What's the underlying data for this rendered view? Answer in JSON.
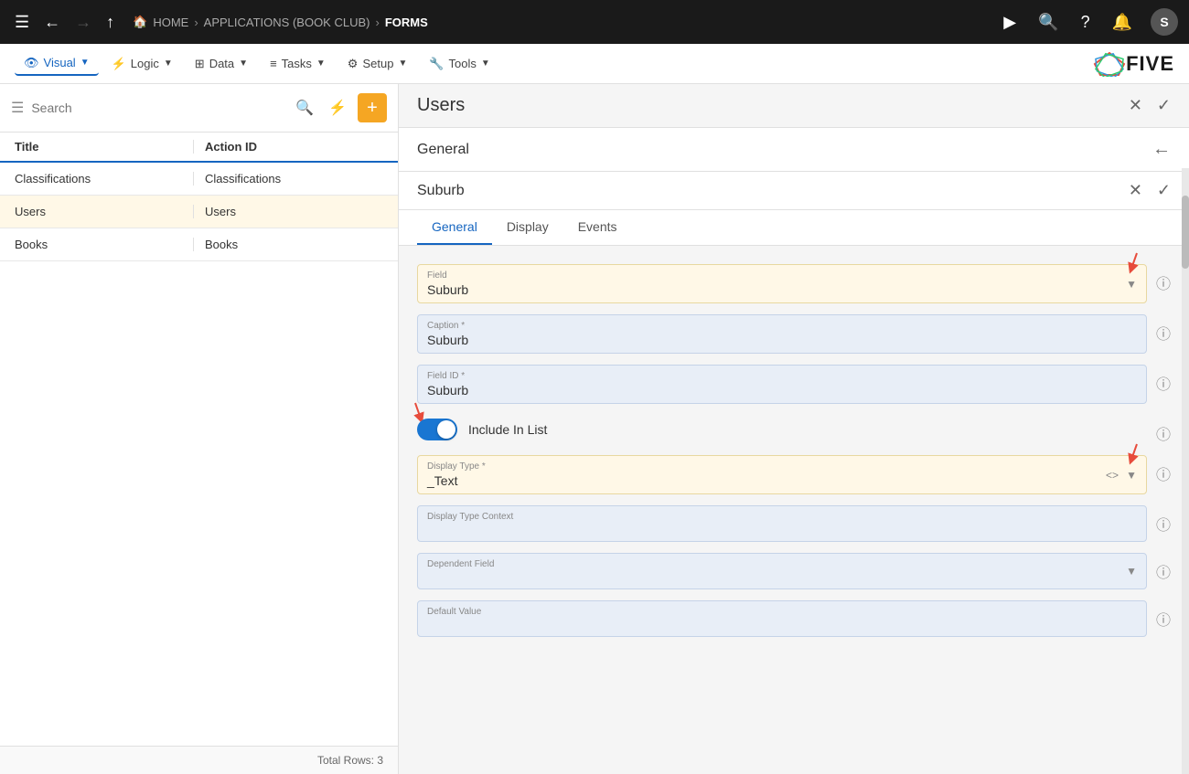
{
  "topNav": {
    "breadcrumbs": [
      {
        "label": "HOME",
        "icon": "🏠"
      },
      {
        "label": "APPLICATIONS (BOOK CLUB)"
      },
      {
        "label": "FORMS",
        "active": true
      }
    ],
    "avatar": "S"
  },
  "secondNav": {
    "items": [
      {
        "label": "Visual",
        "active": true,
        "icon": "👁"
      },
      {
        "label": "Logic",
        "icon": "⚡"
      },
      {
        "label": "Data",
        "icon": "⊞"
      },
      {
        "label": "Tasks",
        "icon": "≡"
      },
      {
        "label": "Setup",
        "icon": "⚙"
      },
      {
        "label": "Tools",
        "icon": "🔧"
      }
    ]
  },
  "leftPanel": {
    "searchPlaceholder": "Search",
    "tableHeaders": {
      "title": "Title",
      "actionId": "Action ID"
    },
    "rows": [
      {
        "title": "Classifications",
        "actionId": "Classifications",
        "selected": false
      },
      {
        "title": "Users",
        "actionId": "Users",
        "selected": true
      },
      {
        "title": "Books",
        "actionId": "Books",
        "selected": false
      }
    ],
    "totalRows": "Total Rows: 3"
  },
  "rightPanel": {
    "usersTitle": "Users",
    "generalTitle": "General",
    "suburbTitle": "Suburb",
    "tabs": [
      {
        "label": "General",
        "active": true
      },
      {
        "label": "Display",
        "active": false
      },
      {
        "label": "Events",
        "active": false
      }
    ],
    "fields": {
      "field": {
        "label": "Field",
        "value": "Suburb"
      },
      "caption": {
        "label": "Caption *",
        "value": "Suburb"
      },
      "fieldId": {
        "label": "Field ID *",
        "value": "Suburb"
      },
      "includeInList": "Include In List",
      "displayType": {
        "label": "Display Type *",
        "value": "_Text"
      },
      "displayTypeContext": {
        "label": "Display Type Context",
        "value": ""
      },
      "dependentField": {
        "label": "Dependent Field",
        "value": ""
      },
      "defaultValue": {
        "label": "Default Value",
        "value": ""
      }
    }
  }
}
